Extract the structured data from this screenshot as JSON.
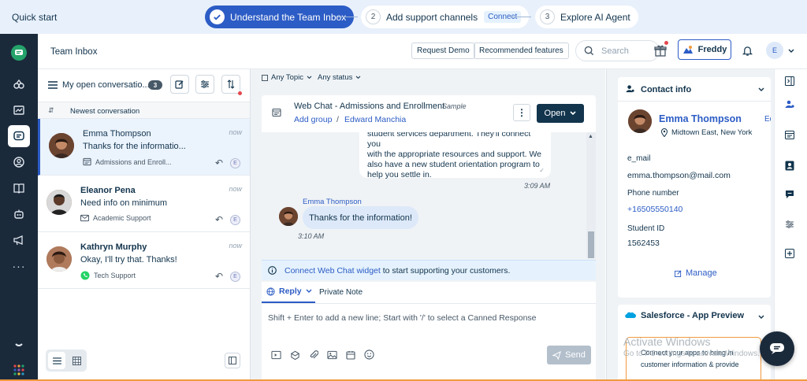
{
  "quick_start": {
    "title": "Quick start",
    "steps": [
      {
        "num": "1",
        "label": "Understand the Team Inbox",
        "state": "done"
      },
      {
        "num": "2",
        "label": "Add support channels",
        "badge": "Connect"
      },
      {
        "num": "3",
        "label": "Explore AI Agent"
      }
    ]
  },
  "header": {
    "title": "Team Inbox",
    "request_demo": "Request Demo",
    "recommended": "Recommended features",
    "search_placeholder": "Search",
    "freddy": "Freddy",
    "avatar_initial": "E"
  },
  "list": {
    "view_name": "My open conversatio...",
    "view_count": "3",
    "sort_label": "Newest conversation",
    "items": [
      {
        "name": "Emma Thompson",
        "message": "Thanks for the informatio...",
        "group": "Admissions and Enroll...",
        "time": "now",
        "agent": "E",
        "channel": "web-chat-icon"
      },
      {
        "name": "Eleanor Pena",
        "message": "Need info on minimum",
        "group": "Academic Support",
        "time": "now",
        "agent": "E",
        "channel": "email-icon"
      },
      {
        "name": "Kathryn Murphy",
        "message": "Okay, I'll try that. Thanks!",
        "group": "Tech Support",
        "time": "now",
        "agent": "E",
        "channel": "whatsapp-icon"
      }
    ]
  },
  "filters": {
    "topic": "Any Topic",
    "status": "Any status"
  },
  "ticket": {
    "title": "Web Chat - Admissions and Enrollment",
    "tag": "Sample",
    "add_group": "Add group",
    "separator": "/",
    "agent": "Edward Manchia",
    "status_button": "Open"
  },
  "messages": {
    "agent_text_lines": [
      "student services department. They'll connect you",
      "with the appropriate resources and support. We",
      "also have a new student orientation program to",
      "help you settle in."
    ],
    "agent_time": "3:09 AM",
    "user_name": "Emma Thompson",
    "user_text": "Thanks for the information!",
    "user_time": "3:10 AM"
  },
  "connect_banner": {
    "link": "Connect Web Chat widget",
    "rest": " to start supporting your customers."
  },
  "reply": {
    "reply_tab": "Reply",
    "note_tab": "Private Note",
    "placeholder": "Shift + Enter to add a new line; Start with '/' to select a Canned Response",
    "send": "Send"
  },
  "contact": {
    "section_title": "Contact info",
    "name": "Emma Thompson",
    "edit": "Ed",
    "location": "Midtown East, New York",
    "email_label": "e_mail",
    "email": "emma.thompson@mail.com",
    "phone_label": "Phone number",
    "phone": "+16505550140",
    "student_label": "Student ID",
    "student_id": "1562453",
    "manage": "Manage"
  },
  "salesforce": {
    "title": "Salesforce - App Preview",
    "text_line1": "Connect your apps to bring in",
    "text_line2": "customer information & provide"
  },
  "watermark": {
    "line1": "Activate Windows",
    "line2": "Go to PC settings to activate Windows."
  },
  "colors": {
    "primary": "#2c5cc5",
    "nav_bg": "#1b2a3b",
    "open_button": "#12344d",
    "accent_orange": "#f09a3e"
  }
}
